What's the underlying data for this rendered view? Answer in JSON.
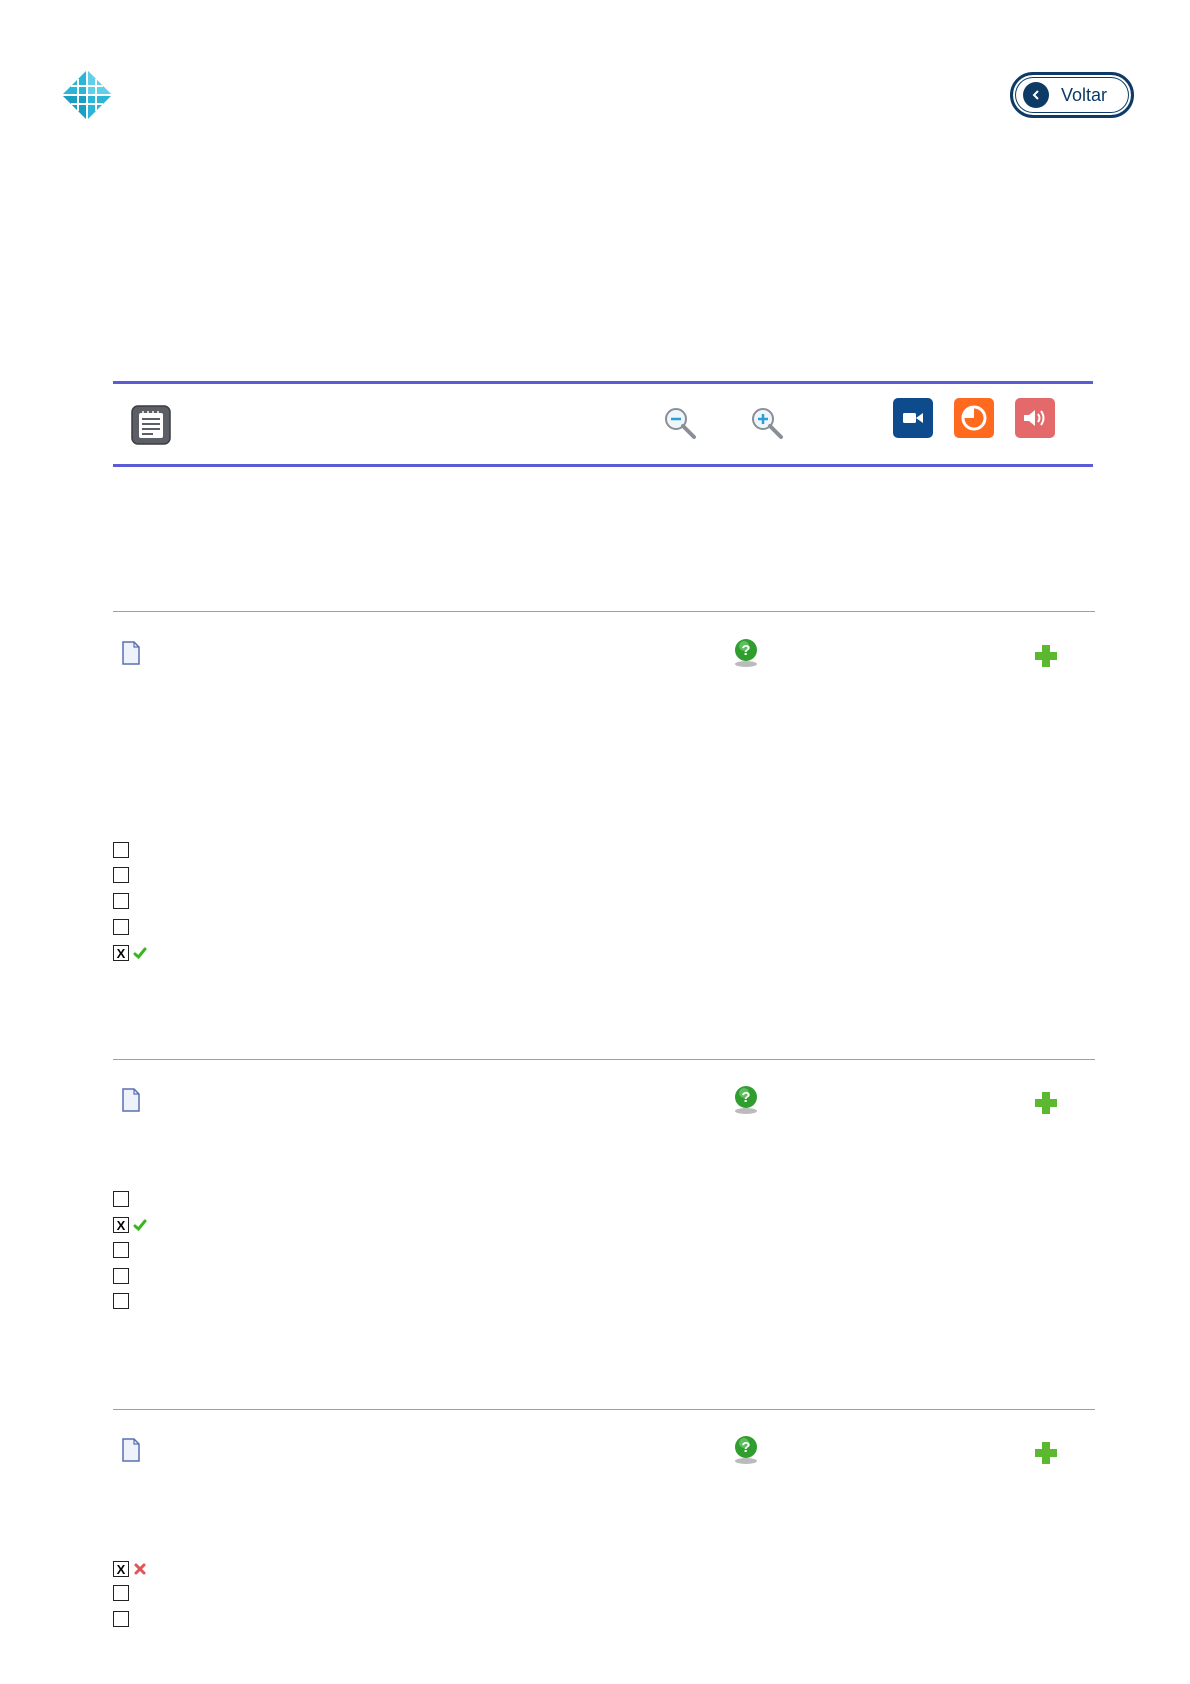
{
  "header": {
    "logo_icon": "diamond-grid-logo",
    "back_button": {
      "label": "Voltar",
      "icon": "chevron-left-icon",
      "color": "#0d3b66"
    }
  },
  "toolbar": {
    "notes_icon": "notepad-icon",
    "zoom_out_icon": "zoom-out-icon",
    "zoom_in_icon": "zoom-in-icon",
    "video_button": {
      "icon": "video-camera-icon",
      "color": "#0d4b8c"
    },
    "chart_button": {
      "icon": "pie-chart-icon",
      "color": "#ff6a1f"
    },
    "audio_button": {
      "icon": "speaker-icon",
      "color": "#e4696a"
    },
    "border_color": "#5b5bd6"
  },
  "questions": [
    {
      "options": [
        {
          "checked": false,
          "result": ""
        },
        {
          "checked": false,
          "result": ""
        },
        {
          "checked": false,
          "result": ""
        },
        {
          "checked": false,
          "result": ""
        },
        {
          "checked": true,
          "result": "correct"
        }
      ]
    },
    {
      "options": [
        {
          "checked": false,
          "result": ""
        },
        {
          "checked": true,
          "result": "correct"
        },
        {
          "checked": false,
          "result": ""
        },
        {
          "checked": false,
          "result": ""
        },
        {
          "checked": false,
          "result": ""
        }
      ]
    },
    {
      "options": [
        {
          "checked": true,
          "result": "incorrect"
        },
        {
          "checked": false,
          "result": ""
        },
        {
          "checked": false,
          "result": ""
        }
      ]
    }
  ],
  "checkbox_mark": "X"
}
